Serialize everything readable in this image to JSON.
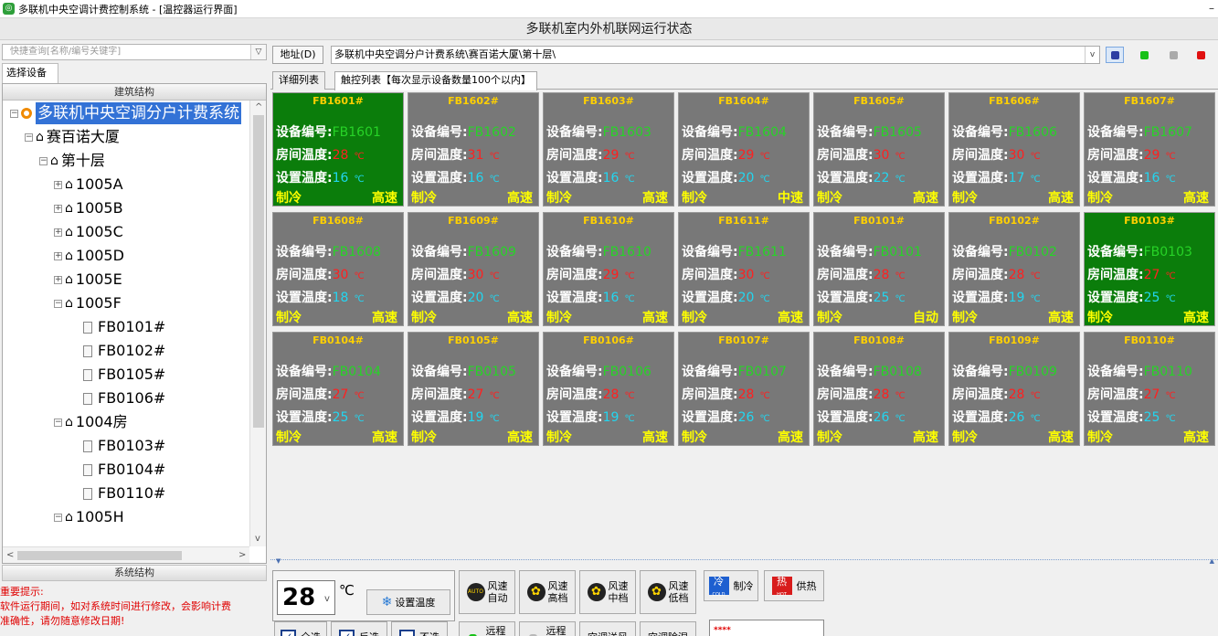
{
  "window": {
    "title": "多联机中央空调计费控制系统 - [温控器运行界面]",
    "minimize": "–"
  },
  "banner": "多联机室内外机联网运行状态",
  "left": {
    "search_placeholder": "快捷查询[名称/编号关键字]",
    "select_tab": "选择设备",
    "tree_header": "建筑结构",
    "system_tab": "系统结构",
    "tree": [
      {
        "label": "多联机中央空调分户计费系统",
        "level": 0,
        "kind": "root",
        "exp": "−"
      },
      {
        "label": "赛百诺大厦",
        "level": 1,
        "kind": "house",
        "exp": "−"
      },
      {
        "label": "第十层",
        "level": 2,
        "kind": "house",
        "exp": "−"
      },
      {
        "label": "1005A",
        "level": 3,
        "kind": "house",
        "exp": "+"
      },
      {
        "label": "1005B",
        "level": 3,
        "kind": "house",
        "exp": "+"
      },
      {
        "label": "1005C",
        "level": 3,
        "kind": "house",
        "exp": "+"
      },
      {
        "label": "1005D",
        "level": 3,
        "kind": "house",
        "exp": "+"
      },
      {
        "label": "1005E",
        "level": 3,
        "kind": "house",
        "exp": "+"
      },
      {
        "label": "1005F",
        "level": 3,
        "kind": "house",
        "exp": "−"
      },
      {
        "label": "FB0101#",
        "level": 4,
        "kind": "doc",
        "exp": ""
      },
      {
        "label": "FB0102#",
        "level": 4,
        "kind": "doc",
        "exp": ""
      },
      {
        "label": "FB0105#",
        "level": 4,
        "kind": "doc",
        "exp": ""
      },
      {
        "label": "FB0106#",
        "level": 4,
        "kind": "doc",
        "exp": ""
      },
      {
        "label": "1004房",
        "level": 3,
        "kind": "house",
        "exp": "−"
      },
      {
        "label": "FB0103#",
        "level": 4,
        "kind": "doc",
        "exp": ""
      },
      {
        "label": "FB0104#",
        "level": 4,
        "kind": "doc",
        "exp": ""
      },
      {
        "label": "FB0110#",
        "level": 4,
        "kind": "doc",
        "exp": ""
      },
      {
        "label": "1005H",
        "level": 3,
        "kind": "house",
        "exp": "−"
      }
    ],
    "notice": {
      "title": "重要提示:",
      "line1": "软件运行期间，如对系统时间进行修改，会影响计费",
      "line2": "准确性，请勿随意修改日期!"
    }
  },
  "address": {
    "label": "地址(D)",
    "value": "多联机中央空调分户计费系统\\赛百诺大厦\\第十层\\"
  },
  "tabs": {
    "detail": "详细列表",
    "touch": "触控列表【每次显示设备数量100个以内】"
  },
  "labels": {
    "id": "设备编号:",
    "room": "房间温度:",
    "set": "设置温度:",
    "unit": "℃"
  },
  "devices": [
    {
      "name": "FB1601#",
      "id": "FB1601",
      "room": "28",
      "set": "16",
      "mode": "制冷",
      "speed": "高速",
      "on": true
    },
    {
      "name": "FB1602#",
      "id": "FB1602",
      "room": "31",
      "set": "16",
      "mode": "制冷",
      "speed": "高速",
      "on": false
    },
    {
      "name": "FB1603#",
      "id": "FB1603",
      "room": "29",
      "set": "16",
      "mode": "制冷",
      "speed": "高速",
      "on": false
    },
    {
      "name": "FB1604#",
      "id": "FB1604",
      "room": "29",
      "set": "20",
      "mode": "制冷",
      "speed": "中速",
      "on": false
    },
    {
      "name": "FB1605#",
      "id": "FB1605",
      "room": "30",
      "set": "22",
      "mode": "制冷",
      "speed": "高速",
      "on": false
    },
    {
      "name": "FB1606#",
      "id": "FB1606",
      "room": "30",
      "set": "17",
      "mode": "制冷",
      "speed": "高速",
      "on": false
    },
    {
      "name": "FB1607#",
      "id": "FB1607",
      "room": "29",
      "set": "16",
      "mode": "制冷",
      "speed": "高速",
      "on": false
    },
    {
      "name": "FB1608#",
      "id": "FB1608",
      "room": "30",
      "set": "18",
      "mode": "制冷",
      "speed": "高速",
      "on": false
    },
    {
      "name": "FB1609#",
      "id": "FB1609",
      "room": "30",
      "set": "20",
      "mode": "制冷",
      "speed": "高速",
      "on": false
    },
    {
      "name": "FB1610#",
      "id": "FB1610",
      "room": "29",
      "set": "16",
      "mode": "制冷",
      "speed": "高速",
      "on": false
    },
    {
      "name": "FB1611#",
      "id": "FB1611",
      "room": "30",
      "set": "20",
      "mode": "制冷",
      "speed": "高速",
      "on": false
    },
    {
      "name": "FB0101#",
      "id": "FB0101",
      "room": "28",
      "set": "25",
      "mode": "制冷",
      "speed": "自动",
      "on": false
    },
    {
      "name": "FB0102#",
      "id": "FB0102",
      "room": "28",
      "set": "19",
      "mode": "制冷",
      "speed": "高速",
      "on": false
    },
    {
      "name": "FB0103#",
      "id": "FB0103",
      "room": "27",
      "set": "25",
      "mode": "制冷",
      "speed": "高速",
      "on": true
    },
    {
      "name": "FB0104#",
      "id": "FB0104",
      "room": "27",
      "set": "25",
      "mode": "制冷",
      "speed": "高速",
      "on": false
    },
    {
      "name": "FB0105#",
      "id": "FB0105",
      "room": "27",
      "set": "19",
      "mode": "制冷",
      "speed": "高速",
      "on": false
    },
    {
      "name": "FB0106#",
      "id": "FB0106",
      "room": "28",
      "set": "19",
      "mode": "制冷",
      "speed": "高速",
      "on": false
    },
    {
      "name": "FB0107#",
      "id": "FB0107",
      "room": "28",
      "set": "26",
      "mode": "制冷",
      "speed": "高速",
      "on": false
    },
    {
      "name": "FB0108#",
      "id": "FB0108",
      "room": "28",
      "set": "26",
      "mode": "制冷",
      "speed": "高速",
      "on": false
    },
    {
      "name": "FB0109#",
      "id": "FB0109",
      "room": "28",
      "set": "26",
      "mode": "制冷",
      "speed": "高速",
      "on": false
    },
    {
      "name": "FB0110#",
      "id": "FB0110",
      "room": "27",
      "set": "25",
      "mode": "制冷",
      "speed": "高速",
      "on": false
    }
  ],
  "controls": {
    "temp_value": "28",
    "temp_unit": "℃",
    "set_temp": "设置温度",
    "fan_auto": {
      "top": "风速",
      "bottom": "自动",
      "icon_text": "AUTO"
    },
    "fan_high": {
      "top": "风速",
      "bottom": "高档"
    },
    "fan_mid": {
      "top": "风速",
      "bottom": "中档"
    },
    "fan_low": {
      "top": "风速",
      "bottom": "低档"
    },
    "cool": {
      "label": "制冷",
      "icon_text": "冷",
      "icon_sub": "COLD"
    },
    "heat": {
      "label": "供热",
      "icon_text": "热",
      "icon_sub": "HOT"
    },
    "select_all": "全选",
    "invert": "反选",
    "none": "不选",
    "remote_on": {
      "top": "远程",
      "bottom": "开机"
    },
    "remote_off": {
      "top": "远程",
      "bottom": "关机"
    },
    "supply_air": "空调送风",
    "dehumid": "空调除湿",
    "password": "****"
  },
  "colors": {
    "card_off": "#787878",
    "card_on": "#0b7d0b",
    "name": "#ffd000",
    "id": "#27d327",
    "room": "#ff2020",
    "set": "#22d6f0",
    "mode": "#ffff00"
  }
}
